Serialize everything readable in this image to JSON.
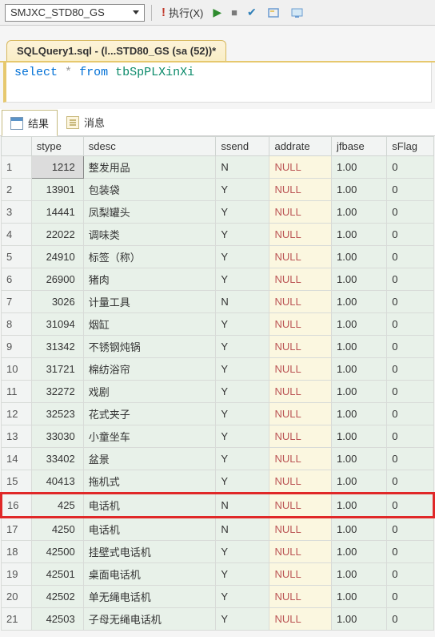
{
  "toolbar": {
    "db_name": "SMJXC_STD80_GS",
    "execute_label": "执行(X)"
  },
  "tab": {
    "title": "SQLQuery1.sql - (l...STD80_GS (sa (52))*"
  },
  "sql": {
    "kw1": "select",
    "star": "*",
    "kw2": "from",
    "ident": "tbSpPLXinXi"
  },
  "subtabs": {
    "results": "结果",
    "messages": "消息"
  },
  "columns": [
    "",
    "stype",
    "sdesc",
    "ssend",
    "addrate",
    "jfbase",
    "sFlag"
  ],
  "rows": [
    {
      "n": "1",
      "stype": "1212",
      "sdesc": "整发用品",
      "ssend": "N",
      "addrate": "NULL",
      "jfbase": "1.00",
      "sflag": "0",
      "sel": true
    },
    {
      "n": "2",
      "stype": "13901",
      "sdesc": "包装袋",
      "ssend": "Y",
      "addrate": "NULL",
      "jfbase": "1.00",
      "sflag": "0"
    },
    {
      "n": "3",
      "stype": "14441",
      "sdesc": "凤梨罐头",
      "ssend": "Y",
      "addrate": "NULL",
      "jfbase": "1.00",
      "sflag": "0"
    },
    {
      "n": "4",
      "stype": "22022",
      "sdesc": "调味类",
      "ssend": "Y",
      "addrate": "NULL",
      "jfbase": "1.00",
      "sflag": "0"
    },
    {
      "n": "5",
      "stype": "24910",
      "sdesc": "标签（称）",
      "ssend": "Y",
      "addrate": "NULL",
      "jfbase": "1.00",
      "sflag": "0"
    },
    {
      "n": "6",
      "stype": "26900",
      "sdesc": "猪肉",
      "ssend": "Y",
      "addrate": "NULL",
      "jfbase": "1.00",
      "sflag": "0"
    },
    {
      "n": "7",
      "stype": "3026",
      "sdesc": "计量工具",
      "ssend": "N",
      "addrate": "NULL",
      "jfbase": "1.00",
      "sflag": "0"
    },
    {
      "n": "8",
      "stype": "31094",
      "sdesc": "烟缸",
      "ssend": "Y",
      "addrate": "NULL",
      "jfbase": "1.00",
      "sflag": "0"
    },
    {
      "n": "9",
      "stype": "31342",
      "sdesc": "不锈钢炖锅",
      "ssend": "Y",
      "addrate": "NULL",
      "jfbase": "1.00",
      "sflag": "0"
    },
    {
      "n": "10",
      "stype": "31721",
      "sdesc": "棉纺浴帘",
      "ssend": "Y",
      "addrate": "NULL",
      "jfbase": "1.00",
      "sflag": "0"
    },
    {
      "n": "11",
      "stype": "32272",
      "sdesc": "戏剧",
      "ssend": "Y",
      "addrate": "NULL",
      "jfbase": "1.00",
      "sflag": "0"
    },
    {
      "n": "12",
      "stype": "32523",
      "sdesc": "花式夹子",
      "ssend": "Y",
      "addrate": "NULL",
      "jfbase": "1.00",
      "sflag": "0"
    },
    {
      "n": "13",
      "stype": "33030",
      "sdesc": "小童坐车",
      "ssend": "Y",
      "addrate": "NULL",
      "jfbase": "1.00",
      "sflag": "0"
    },
    {
      "n": "14",
      "stype": "33402",
      "sdesc": "盆景",
      "ssend": "Y",
      "addrate": "NULL",
      "jfbase": "1.00",
      "sflag": "0"
    },
    {
      "n": "15",
      "stype": "40413",
      "sdesc": "拖机式",
      "ssend": "Y",
      "addrate": "NULL",
      "jfbase": "1.00",
      "sflag": "0"
    },
    {
      "n": "16",
      "stype": "425",
      "sdesc": "电话机",
      "ssend": "N",
      "addrate": "NULL",
      "jfbase": "1.00",
      "sflag": "0",
      "hl": true
    },
    {
      "n": "17",
      "stype": "4250",
      "sdesc": "电话机",
      "ssend": "N",
      "addrate": "NULL",
      "jfbase": "1.00",
      "sflag": "0"
    },
    {
      "n": "18",
      "stype": "42500",
      "sdesc": "挂壁式电话机",
      "ssend": "Y",
      "addrate": "NULL",
      "jfbase": "1.00",
      "sflag": "0"
    },
    {
      "n": "19",
      "stype": "42501",
      "sdesc": "桌面电话机",
      "ssend": "Y",
      "addrate": "NULL",
      "jfbase": "1.00",
      "sflag": "0"
    },
    {
      "n": "20",
      "stype": "42502",
      "sdesc": "单无绳电话机",
      "ssend": "Y",
      "addrate": "NULL",
      "jfbase": "1.00",
      "sflag": "0"
    },
    {
      "n": "21",
      "stype": "42503",
      "sdesc": "子母无绳电话机",
      "ssend": "Y",
      "addrate": "NULL",
      "jfbase": "1.00",
      "sflag": "0"
    }
  ]
}
